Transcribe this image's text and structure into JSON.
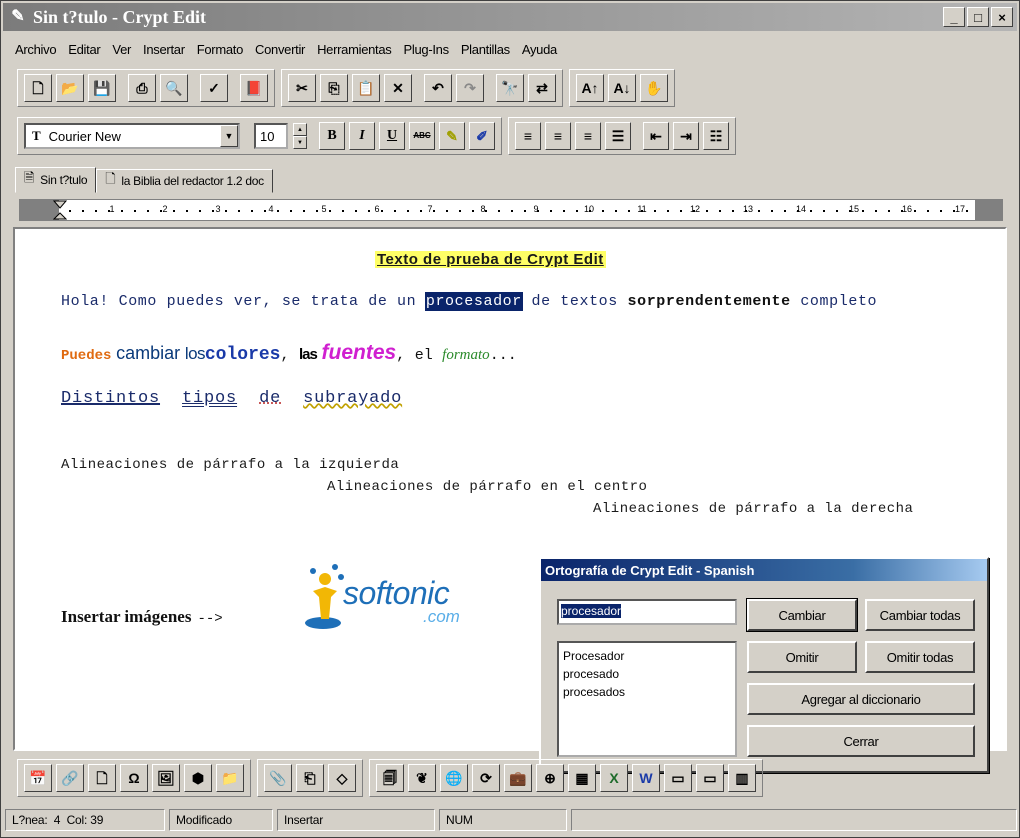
{
  "window": {
    "title": "Sin t?tulo - Crypt Edit",
    "minimize": "_",
    "maximize": "□",
    "close": "×"
  },
  "menu": [
    "Archivo",
    "Editar",
    "Ver",
    "Insertar",
    "Formato",
    "Convertir",
    "Herramientas",
    "Plug-Ins",
    "Plantillas",
    "Ayuda"
  ],
  "format_bar": {
    "font_name": "Courier New",
    "font_size": "10",
    "bold": "B",
    "italic": "I",
    "underline": "U",
    "strike": "ABC"
  },
  "tabs": [
    {
      "label": "Sin t?tulo",
      "active": true
    },
    {
      "label": "la Biblia del redactor 1.2 doc",
      "active": false
    }
  ],
  "ruler_numbers": [
    "1",
    "2",
    "3",
    "4",
    "5",
    "6",
    "7",
    "8",
    "9",
    "10",
    "11",
    "12",
    "13",
    "14",
    "15",
    "16",
    "17"
  ],
  "document": {
    "heading": "Texto de prueba de Crypt Edit",
    "line1": {
      "before": "Hola! Como puedes ver, se trata de un ",
      "selected": "procesador",
      "middle": " de textos ",
      "bold": "sorprendentemente",
      "after": " completo"
    },
    "line2": {
      "w1": "Puedes",
      "w2": "cambiar",
      "w3": "los",
      "w4": "colores",
      "comma1": ",",
      "w5": "las",
      "w6": "fuentes",
      "comma2": ",",
      "w7": "el",
      "w8": "formato",
      "ellipsis": "..."
    },
    "line3": [
      "Distintos",
      "tipos",
      "de",
      "subrayado"
    ],
    "align_left": "Alineaciones de párrafo a la izquierda",
    "align_center": "Alineaciones de párrafo en el centro",
    "align_right": "Alineaciones de párrafo a la derecha",
    "insert_images": "Insertar imágenes",
    "insert_arrow": "-->",
    "logo_text": "softonic",
    "logo_com": ".com"
  },
  "spell_dialog": {
    "title": "Ortografía de Crypt Edit - Spanish",
    "word": "procesador",
    "suggestions": [
      "Procesador",
      "procesado",
      "procesados"
    ],
    "change": "Cambiar",
    "change_all": "Cambiar todas",
    "ignore": "Omitir",
    "ignore_all": "Omitir todas",
    "add": "Agregar al diccionario",
    "close": "Cerrar"
  },
  "status": {
    "line": "L?nea:",
    "line_val": "4",
    "col": "Col:",
    "col_val": "39",
    "modified": "Modificado",
    "mode": "Insertar",
    "num": "NUM"
  },
  "colors": {
    "selection": "#0a246a",
    "heading_bg": "#ffff66",
    "dialog_title": "#0a246a"
  }
}
